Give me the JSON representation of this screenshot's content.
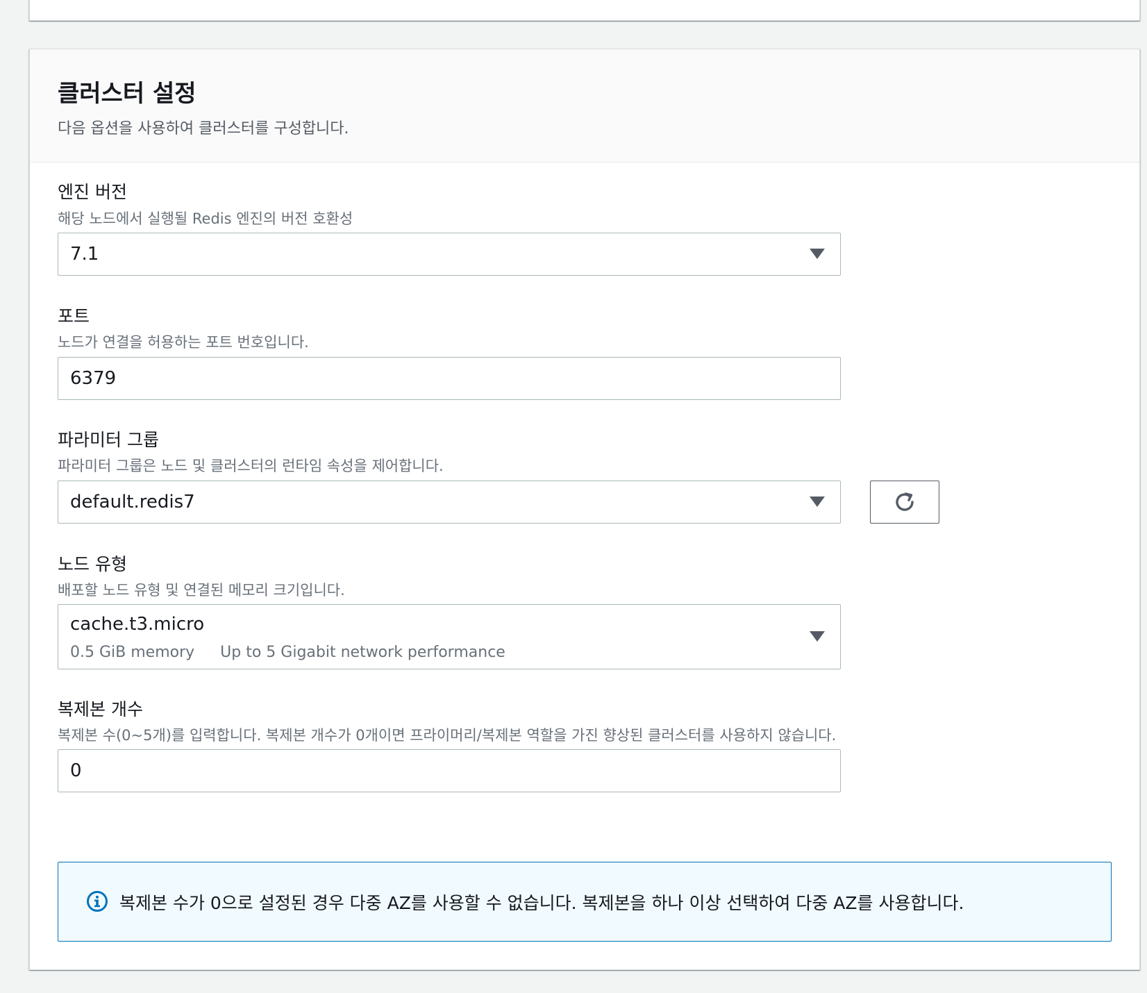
{
  "section": {
    "title": "클러스터 설정",
    "description": "다음 옵션을 사용하여 클러스터를 구성합니다."
  },
  "engine_version": {
    "label": "엔진 버전",
    "description": "해당 노드에서 실행될 Redis 엔진의 버전 호환성",
    "value": "7.1"
  },
  "port": {
    "label": "포트",
    "description": "노드가 연결을 허용하는 포트 번호입니다.",
    "value": "6379"
  },
  "parameter_group": {
    "label": "파라미터 그룹",
    "description": "파라미터 그룹은 노드 및 클러스터의 런타임 속성을 제어합니다.",
    "value": "default.redis7",
    "refresh_icon": "refresh-icon"
  },
  "node_type": {
    "label": "노드 유형",
    "description": "배포할 노드 유형 및 연결된 메모리 크기입니다.",
    "value": "cache.t3.micro",
    "memory": "0.5 GiB memory",
    "network": "Up to 5 Gigabit network performance"
  },
  "replicas": {
    "label": "복제본 개수",
    "description": "복제본 수(0~5개)를 입력합니다. 복제본 개수가 0개이면 프라이머리/복제본 역할을 가진 향상된 클러스터를 사용하지 않습니다.",
    "value": "0"
  },
  "info_alert": {
    "icon": "info-icon",
    "text": "복제본 수가 0으로 설정된 경우 다중 AZ를 사용할 수 없습니다. 복제본을 하나 이상 선택하여 다중 AZ를 사용합니다."
  },
  "colors": {
    "background": "#f2f3f3",
    "info_border": "#0073bb",
    "info_background": "#f1faff"
  }
}
